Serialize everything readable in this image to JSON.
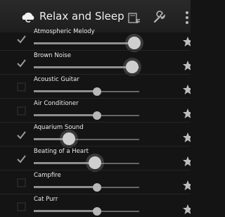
{
  "app": {
    "title": "Relax and Sleep",
    "icons": {
      "app": "cloud-moon-icon",
      "timer": "timer-icon",
      "settings": "wrench-icon",
      "overflow": "overflow-menu-icon"
    }
  },
  "sounds": [
    {
      "label": "Atmospheric Melody",
      "checked": true,
      "volume": 0.95,
      "favorite_icon": "star-icon"
    },
    {
      "label": "Brown Noise",
      "checked": true,
      "volume": 0.93,
      "favorite_icon": "star-icon"
    },
    {
      "label": "Acoustic Guitar",
      "checked": false,
      "volume": 0.6,
      "favorite_icon": "star-icon"
    },
    {
      "label": "Air Conditioner",
      "checked": false,
      "volume": 0.6,
      "favorite_icon": "star-icon"
    },
    {
      "label": "Aquarium Sound",
      "checked": true,
      "volume": 0.33,
      "favorite_icon": "star-icon"
    },
    {
      "label": "Beating of a Heart",
      "checked": true,
      "volume": 0.58,
      "favorite_icon": "star-icon"
    },
    {
      "label": "Campfire",
      "checked": false,
      "volume": 0.6,
      "favorite_icon": "star-icon"
    },
    {
      "label": "Cat Purr",
      "checked": false,
      "volume": 0.6,
      "favorite_icon": "star-icon"
    }
  ]
}
